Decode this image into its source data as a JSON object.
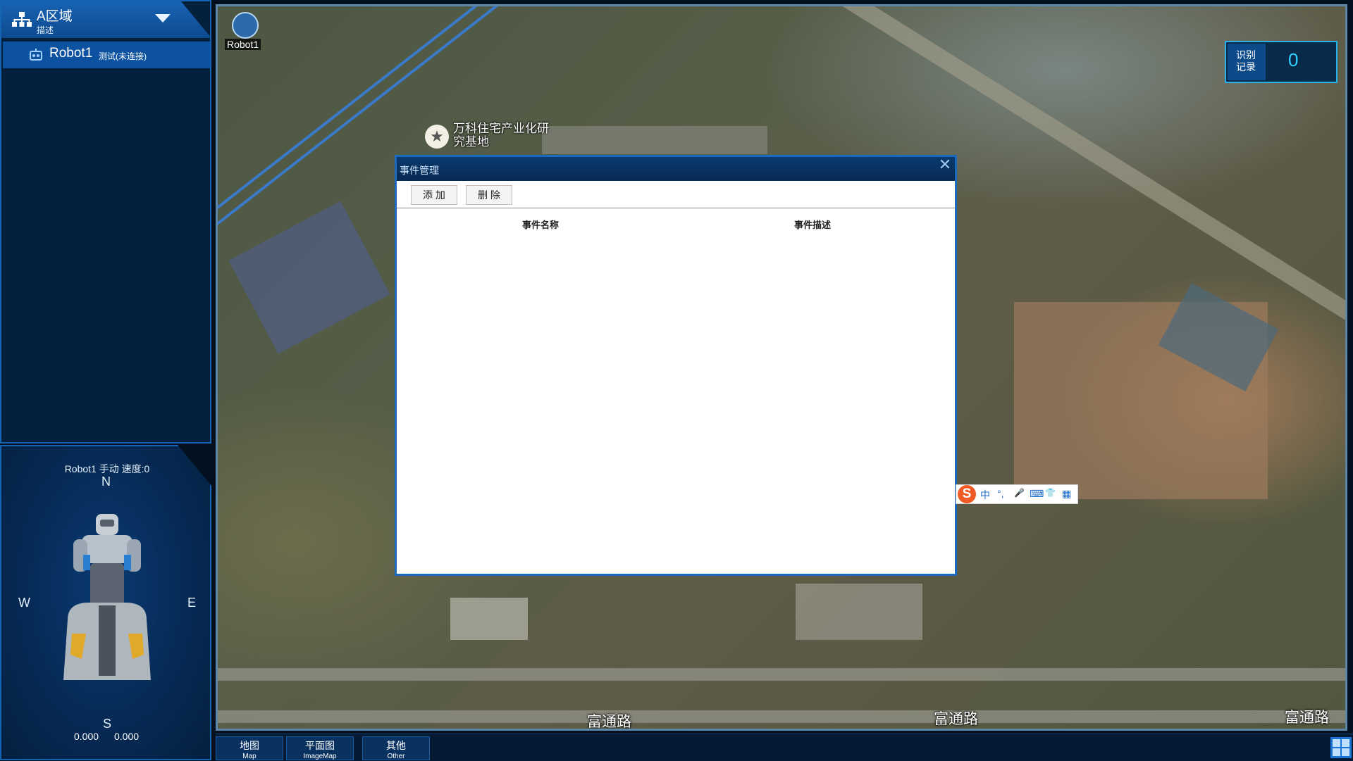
{
  "area": {
    "title": "A区域",
    "description": "描述"
  },
  "robot_list": [
    {
      "name": "Robot1",
      "status": "测试(未连接)"
    }
  ],
  "robot_panel": {
    "status_line": "Robot1   手动   速度:0",
    "compass": {
      "n": "N",
      "s": "S",
      "w": "W",
      "e": "E"
    },
    "coord_x": "0.000",
    "coord_y": "0.000"
  },
  "map": {
    "robot_label": "Robot1",
    "poi_label": "万科住宅产业化研究基地",
    "road_labels": [
      "富通路",
      "富通路",
      "富通路"
    ],
    "record": {
      "label_line1": "识别",
      "label_line2": "记录",
      "count": "0"
    }
  },
  "dialog": {
    "title": "事件管理",
    "close": "✕",
    "buttons": {
      "add": "添 加",
      "delete": "删 除"
    },
    "columns": [
      "事件名称",
      "事件描述"
    ],
    "rows": []
  },
  "ime": {
    "logo": "S",
    "items": [
      "中",
      "°,",
      "🎤",
      "⌨",
      "👕",
      "▦"
    ]
  },
  "bottom_tabs": [
    {
      "cn": "地图",
      "en": "Map"
    },
    {
      "cn": "平面图",
      "en": "ImageMap"
    },
    {
      "cn": "其他",
      "en": "Other"
    }
  ],
  "colors": {
    "panel_bg": "#04203d",
    "accent_blue": "#1564b3",
    "highlight": "#2fd2ff"
  }
}
